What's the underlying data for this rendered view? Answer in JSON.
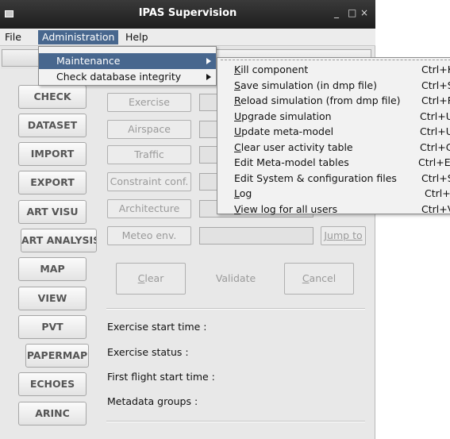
{
  "window": {
    "title": "IPAS Supervision",
    "controls": {
      "minimize": "_",
      "maximize": "□",
      "close": "×"
    }
  },
  "menubar": {
    "file": "File",
    "administration": "Administration",
    "help": "Help"
  },
  "admin_menu": {
    "items": [
      {
        "label": "Maintenance"
      },
      {
        "label": "Check database integrity"
      }
    ]
  },
  "maintenance_submenu": [
    {
      "mnemonic": "K",
      "rest": "ill component",
      "shortcut": "Ctrl+K"
    },
    {
      "mnemonic": "S",
      "rest": "ave simulation (in dmp file)",
      "shortcut": "Ctrl+S"
    },
    {
      "mnemonic": "R",
      "rest": "eload simulation (from dmp file)",
      "shortcut": "Ctrl+R"
    },
    {
      "mnemonic": "U",
      "rest": "pgrade simulation",
      "shortcut": "Ctrl+U"
    },
    {
      "mnemonic": "U",
      "rest": "pdate meta-model",
      "shortcut": "Ctrl+U"
    },
    {
      "mnemonic": "C",
      "rest": "lear user activity table",
      "shortcut": "Ctrl+C"
    },
    {
      "mnemonic": "",
      "rest": "Edit Meta-model tables",
      "shortcut": "Ctrl+E"
    },
    {
      "mnemonic": "",
      "rest": "Edit System & configuration files",
      "shortcut": "Ctrl+S"
    },
    {
      "mnemonic": "L",
      "rest": "og",
      "shortcut": "Ctrl+L"
    },
    {
      "mnemonic": "V",
      "rest": "iew log for all users",
      "shortcut": "Ctrl+V"
    }
  ],
  "nav": [
    "CHECK",
    "DATASET",
    "IMPORT",
    "EXPORT",
    "ART VISU",
    "ART ANALYSIS",
    "MAP",
    "VIEW",
    "PVT",
    "PAPERMAP",
    "ECHOES",
    "ARINC"
  ],
  "config_buttons": [
    "Exercise",
    "Airspace",
    "Traffic",
    "Constraint conf.",
    "Architecture",
    "Meteo env."
  ],
  "jump_label": "Jump to",
  "actions": {
    "clear_mnemonic": "C",
    "clear_rest": "lear",
    "validate": "Validate",
    "cancel_mnemonic": "C",
    "cancel_rest": "ancel"
  },
  "info": {
    "exercise_start": "Exercise start time :",
    "exercise_status": "Exercise status :",
    "first_flight": "First flight start time :",
    "metadata": "Metadata groups :"
  }
}
